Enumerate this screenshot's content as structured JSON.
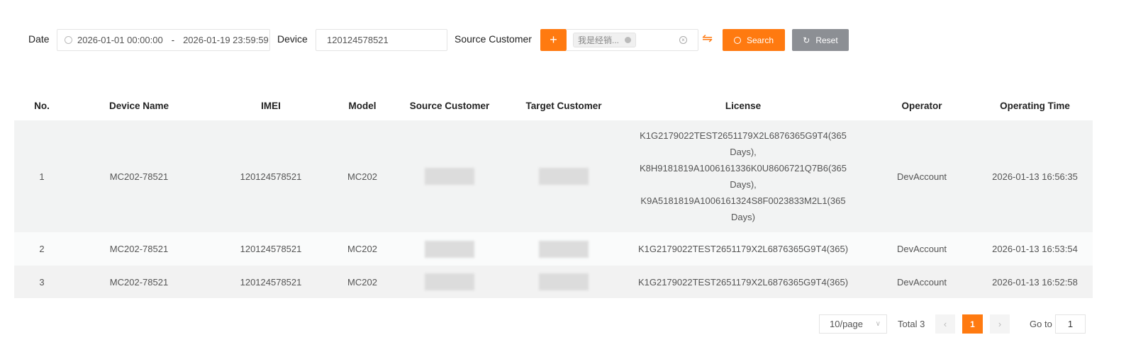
{
  "filters": {
    "date_label": "Date",
    "date_start": "2026-01-01 00:00:00",
    "date_sep": "-",
    "date_end": "2026-01-19 23:59:59",
    "device_label": "Device",
    "device_value": "120124578521",
    "source_label": "Source Customer",
    "source_tag": "我是经销...",
    "search_label": "Search",
    "reset_label": "Reset"
  },
  "colors": {
    "accent": "#ff7a10",
    "reset": "#8c8f94"
  },
  "table": {
    "columns": [
      "No.",
      "Device Name",
      "IMEI",
      "Model",
      "Source Customer",
      "Target Customer",
      "License",
      "Operator",
      "Operating Time"
    ],
    "rows": [
      {
        "no": "1",
        "device_name": "MC202-78521",
        "imei": "120124578521",
        "model": "MC202",
        "license": [
          "K1G2179022TEST2651179X2L6876365G9T4(365",
          "Days),",
          "K8H9181819A1006161336K0U8606721Q7B6(365",
          "Days),",
          "K9A5181819A1006161324S8F0023833M2L1(365",
          "Days)"
        ],
        "operator": "DevAccount",
        "time": "2026-01-13 16:56:35"
      },
      {
        "no": "2",
        "device_name": "MC202-78521",
        "imei": "120124578521",
        "model": "MC202",
        "license": [
          "K1G2179022TEST2651179X2L6876365G9T4(365)"
        ],
        "operator": "DevAccount",
        "time": "2026-01-13 16:53:54"
      },
      {
        "no": "3",
        "device_name": "MC202-78521",
        "imei": "120124578521",
        "model": "MC202",
        "license": [
          "K1G2179022TEST2651179X2L6876365G9T4(365)"
        ],
        "operator": "DevAccount",
        "time": "2026-01-13 16:52:58"
      }
    ]
  },
  "pagination": {
    "page_size": "10/page",
    "total": "Total 3",
    "current": "1",
    "goto_label": "Go to",
    "goto_value": "1"
  }
}
